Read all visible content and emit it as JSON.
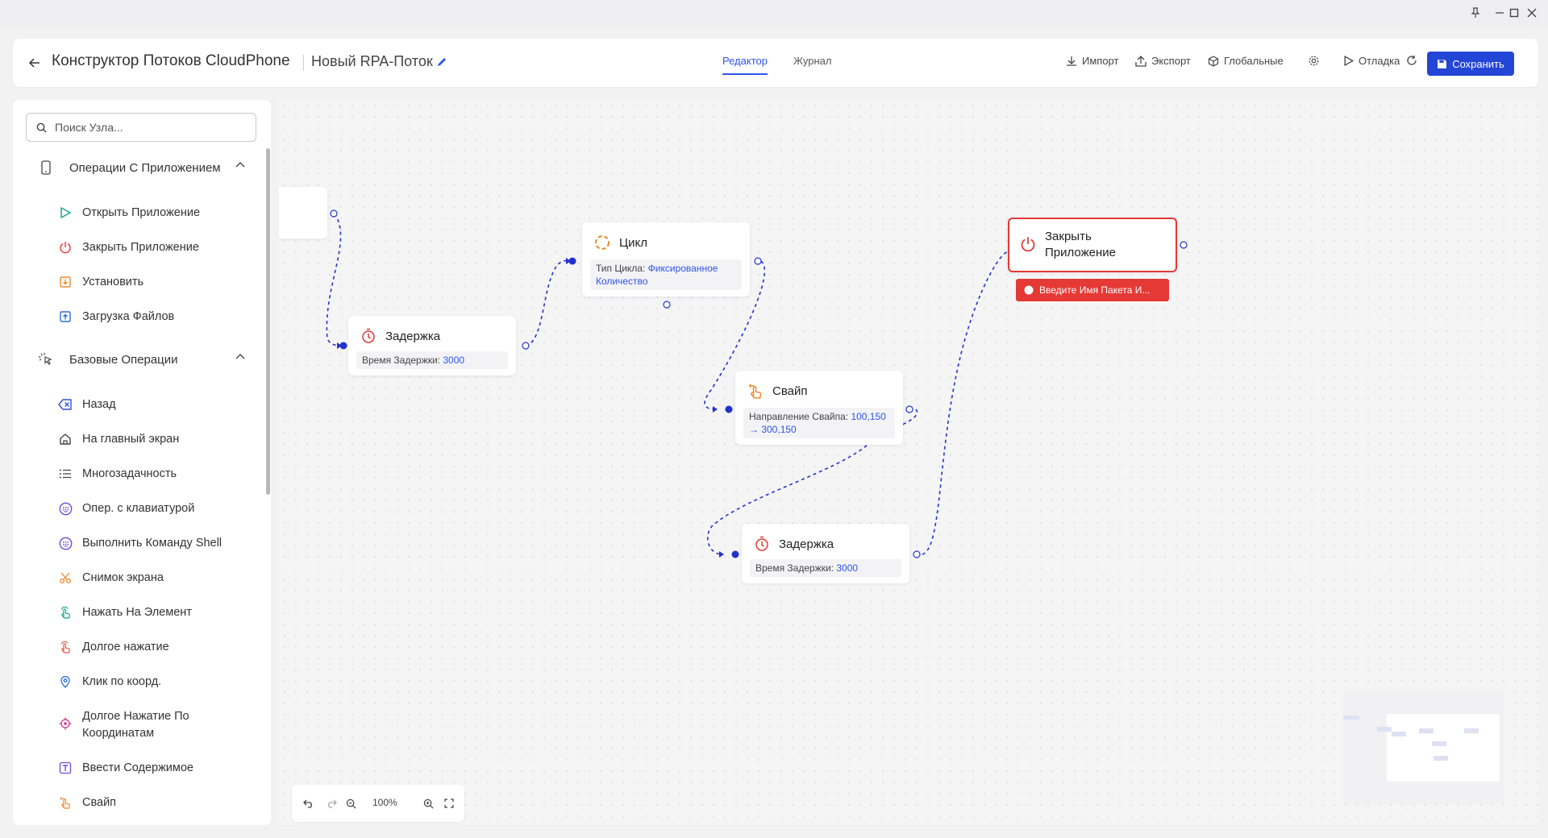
{
  "header": {
    "app_title": "Конструктор Потоков CloudPhone",
    "flow_name": "Новый RPA-Поток",
    "tabs": [
      {
        "label": "Редактор",
        "active": true
      },
      {
        "label": "Журнал",
        "active": false
      }
    ],
    "toolbar": {
      "import_label": "Импорт",
      "export_label": "Экспорт",
      "globals_label": "Глобальные",
      "debug_label": "Отладка",
      "save_label": "Сохранить"
    }
  },
  "sidebar": {
    "search_placeholder": "Поиск Узла...",
    "categories": [
      {
        "label": "Операции С Приложением",
        "expanded": true,
        "items": [
          {
            "label": "Открыть Приложение",
            "icon": "play-icon"
          },
          {
            "label": "Закрыть Приложение",
            "icon": "power-icon"
          },
          {
            "label": "Установить",
            "icon": "install-icon"
          },
          {
            "label": "Загрузка Файлов",
            "icon": "upload-icon"
          }
        ]
      },
      {
        "label": "Базовые Операции",
        "expanded": true,
        "items": [
          {
            "label": "Назад",
            "icon": "back-icon"
          },
          {
            "label": "На главный экран",
            "icon": "home-icon"
          },
          {
            "label": "Многозадачность",
            "icon": "list-icon"
          },
          {
            "label": "Опер. с клавиатурой",
            "icon": "keyboard-icon"
          },
          {
            "label": "Выполнить Команду Shell",
            "icon": "shell-icon"
          },
          {
            "label": "Снимок экрана",
            "icon": "scissors-icon"
          },
          {
            "label": "Нажать На Элемент",
            "icon": "tap-icon"
          },
          {
            "label": "Долгое нажатие",
            "icon": "long-press-icon"
          },
          {
            "label": "Клик по коорд.",
            "icon": "location-icon"
          },
          {
            "label": "Долгое Нажатие По Координатам",
            "icon": "target-icon"
          },
          {
            "label": "Ввести Содержимое",
            "icon": "text-icon"
          },
          {
            "label": "Свайп",
            "icon": "swipe-icon"
          }
        ]
      }
    ]
  },
  "nodes": {
    "delay1": {
      "title": "Задержка",
      "field_label": "Время Задержки:",
      "field_value": "3000"
    },
    "loop": {
      "title": "Цикл",
      "field_label": "Тип Цикла:",
      "field_value": "Фиксированное Количество"
    },
    "swipe": {
      "title": "Свайп",
      "field_label": "Направление Свайпа:",
      "field_value": "100,150 → 300,150"
    },
    "delay2": {
      "title": "Задержка",
      "field_label": "Время Задержки:",
      "field_value": "3000"
    },
    "close_app": {
      "title": "Закрыть Приложение",
      "error": "Введите Имя Пакета И..."
    }
  },
  "zoom": {
    "level": "100%"
  },
  "colors": {
    "accent": "#2f54eb",
    "save": "#2346d6",
    "error": "#e53935",
    "edge": "#2233cc"
  }
}
